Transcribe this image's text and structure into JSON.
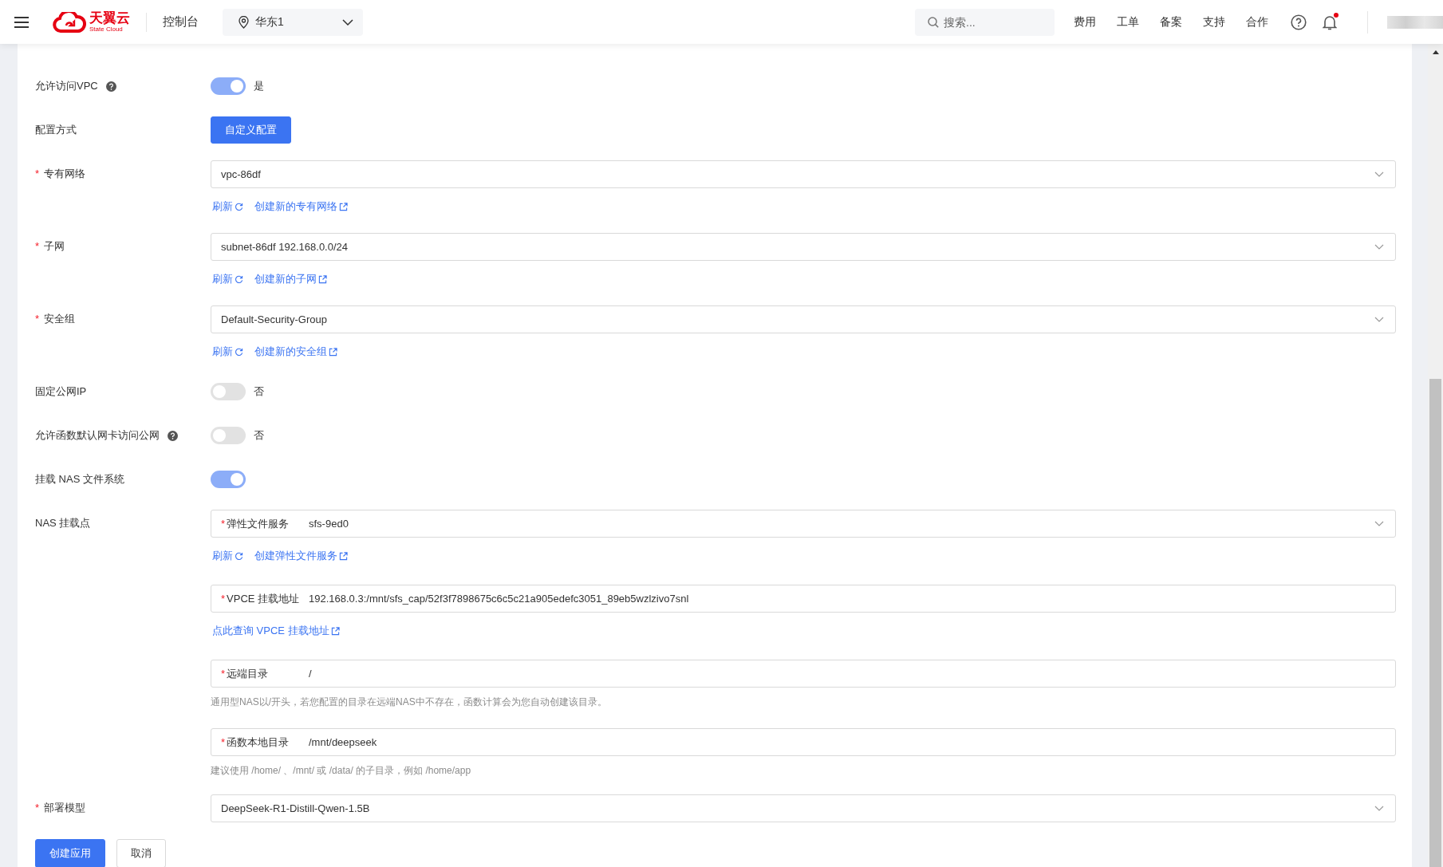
{
  "header": {
    "logo": {
      "name": "天翼云",
      "sub": "State Cloud"
    },
    "console": "控制台",
    "region": "华东1",
    "search": {
      "placeholder": "搜索..."
    },
    "nav": [
      "费用",
      "工单",
      "备案",
      "支持",
      "合作"
    ],
    "notification_dot": true
  },
  "form": {
    "rows": [
      {
        "kind": "toggle",
        "label": "允许访问VPC",
        "help": true,
        "on": true,
        "text": "是"
      },
      {
        "kind": "choice",
        "label": "配置方式",
        "options": [
          {
            "label": "自定义配置",
            "selected": true
          }
        ]
      },
      {
        "kind": "select",
        "label": "专有网络",
        "mark": "*",
        "value": "vpc-86df",
        "links": [
          {
            "text": "刷新",
            "kind": "refresh"
          },
          {
            "text": "创建新的专有网络",
            "kind": "external"
          }
        ]
      },
      {
        "kind": "select",
        "label": "子网",
        "mark": "*",
        "value": "subnet-86df 192.168.0.0/24",
        "links": [
          {
            "text": "刷新",
            "kind": "refresh"
          },
          {
            "text": "创建新的子网",
            "kind": "external"
          }
        ]
      },
      {
        "kind": "select",
        "label": "安全组",
        "mark": "*",
        "value": "Default-Security-Group",
        "links": [
          {
            "text": "刷新",
            "kind": "refresh"
          },
          {
            "text": "创建新的安全组",
            "kind": "external"
          }
        ]
      },
      {
        "kind": "toggle",
        "label": "固定公网IP",
        "help": false,
        "on": false,
        "text": "否"
      },
      {
        "kind": "toggle",
        "label": "允许函数默认网卡访问公网",
        "help": true,
        "on": false,
        "text": "否"
      },
      {
        "kind": "toggle",
        "label": "挂载 NAS 文件系统",
        "help": false,
        "on": true
      },
      {
        "kind": "nas",
        "label": "NAS 挂载点",
        "fields": [
          {
            "kind": "select",
            "mark": "*",
            "label": "弹性文件服务",
            "value": "sfs-9ed0",
            "links": [
              {
                "text": "刷新",
                "kind": "refresh"
              },
              {
                "text": "创建弹性文件服务",
                "kind": "external"
              }
            ]
          },
          {
            "kind": "input",
            "mark": "*",
            "label": "VPCE 挂载地址",
            "value": "192.168.0.3:/mnt/sfs_cap/52f3f7898675c6c5c21a905edefc3051_89eb5wzlzivo7snl",
            "links": [
              {
                "text": "点此查询 VPCE 挂载地址",
                "kind": "external"
              }
            ]
          },
          {
            "kind": "input",
            "mark": "*",
            "label": "远端目录",
            "value": "/",
            "hint": "通用型NAS以/开头，若您配置的目录在远端NAS中不存在，函数计算会为您自动创建该目录。"
          },
          {
            "kind": "input",
            "mark": "*",
            "label": "函数本地目录",
            "value": "/mnt/deepseek",
            "hint": "建议使用 /home/ 、/mnt/ 或 /data/ 的子目录，例如 /home/app"
          }
        ]
      },
      {
        "kind": "select",
        "label": "部署模型",
        "mark": "*",
        "value": "DeepSeek-R1-Distill-Qwen-1.5B"
      }
    ]
  },
  "actions": [
    {
      "label": "创建应用",
      "primary": true
    },
    {
      "label": "取消",
      "primary": false
    }
  ]
}
